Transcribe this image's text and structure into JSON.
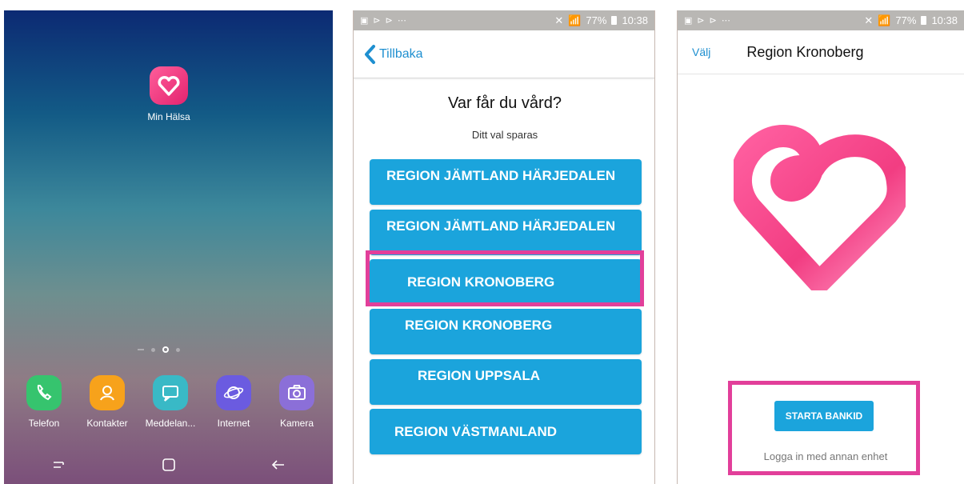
{
  "home_screen": {
    "app": {
      "label": "Min Hälsa",
      "icon": "heart-app-icon"
    },
    "dock": [
      {
        "label": "Telefon",
        "icon": "phone-icon",
        "color": "#36c46e"
      },
      {
        "label": "Kontakter",
        "icon": "contacts-icon",
        "color": "#f7a21b"
      },
      {
        "label": "Meddelan...",
        "icon": "messages-icon",
        "color": "#39b9c6"
      },
      {
        "label": "Internet",
        "icon": "internet-icon",
        "color": "#6b5be0"
      },
      {
        "label": "Kamera",
        "icon": "camera-icon",
        "color": "#d4607f"
      }
    ]
  },
  "statusbar": {
    "left_icons": [
      "image-icon",
      "play-icon",
      "play-icon",
      "more-icon"
    ],
    "signal": "4G",
    "battery": "77%",
    "time": "10:38"
  },
  "region_screen": {
    "back_label": "Tillbaka",
    "title": "Var får du vård?",
    "subtitle": "Ditt val sparas",
    "regions": [
      "REGION JÄMTLAND HÄRJEDALEN",
      "REGION JÄMTLAND HÄRJEDALEN",
      "REGION KRONOBERG",
      "REGION KRONOBERG",
      "REGION UPPSALA",
      "REGION VÄSTMANLAND"
    ],
    "highlighted_index": 2
  },
  "login_screen": {
    "nav_label": "Välj",
    "title": "Region Kronoberg",
    "bankid_button": "STARTA BANKID",
    "other_device_link": "Logga in med annan enhet"
  },
  "colors": {
    "accent_blue": "#1ba4dc",
    "highlight_pink": "#e23f9a",
    "link_blue": "#1e8fd0"
  }
}
